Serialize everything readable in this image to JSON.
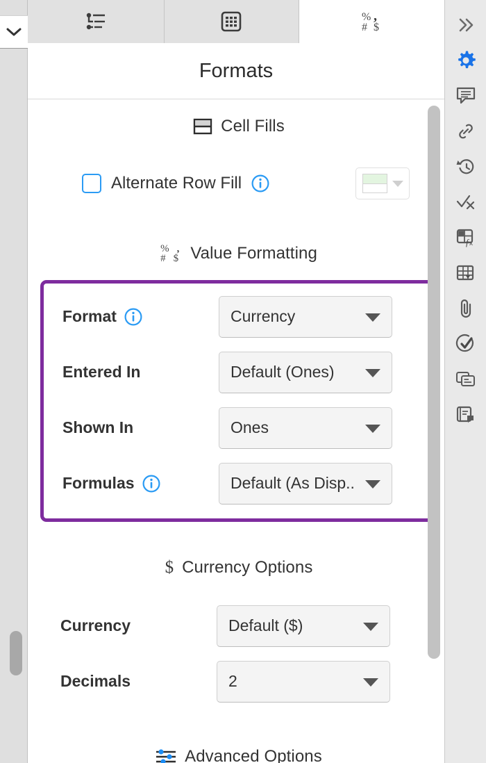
{
  "window": {
    "title": "Formats"
  },
  "left_rail": {
    "collapse_button": {
      "name": "collapse-panel",
      "icon": "chevron-down-icon"
    },
    "scrollbar": {
      "name": "left-scrollbar"
    }
  },
  "tabs": [
    {
      "id": "tab-outline",
      "icon": "outline-list-icon",
      "label": "Outline",
      "active": false
    },
    {
      "id": "tab-table",
      "icon": "grid-table-icon",
      "label": "Table",
      "active": false
    },
    {
      "id": "tab-formats",
      "icon": "number-format-icon",
      "label": "Formats",
      "active": true
    }
  ],
  "sections": [
    {
      "id": "cell-fills",
      "icon": "cell-fill-icon",
      "title": "Cell Fills",
      "checkbox": {
        "label": "Alternate Row Fill",
        "checked": false,
        "info": "i",
        "swatch": {
          "top_color": "#e3f5e0",
          "bottom_color": "#ffffff"
        }
      }
    },
    {
      "id": "value-formatting",
      "icon": "number-format-icon",
      "title": "Value Formatting",
      "highlighted": true,
      "highlight_color": "#7e2c9e",
      "fields": [
        {
          "label": "Format",
          "info": "i",
          "value": "Currency"
        },
        {
          "label": "Entered In",
          "info": null,
          "value": "Default (Ones)"
        },
        {
          "label": "Shown In",
          "info": null,
          "value": "Ones"
        },
        {
          "label": "Formulas",
          "info": "i",
          "value": "Default (As Disp..."
        }
      ]
    },
    {
      "id": "currency-options",
      "icon": "dollar-icon",
      "icon_glyph": "$",
      "title": "Currency Options",
      "fields": [
        {
          "label": "Currency",
          "info": null,
          "value": "Default ($)"
        },
        {
          "label": "Decimals",
          "info": null,
          "value": "2"
        }
      ]
    },
    {
      "id": "advanced-options",
      "icon": "sliders-icon",
      "title": "Advanced Options"
    }
  ],
  "right_rail": [
    {
      "id": "expand",
      "icon": "chevrons-right-icon",
      "active": false
    },
    {
      "id": "settings",
      "icon": "gear-icon",
      "active": true
    },
    {
      "id": "comments",
      "icon": "comment-icon",
      "active": false
    },
    {
      "id": "links",
      "icon": "link-icon",
      "active": false
    },
    {
      "id": "history",
      "icon": "history-icon",
      "active": false
    },
    {
      "id": "check-x",
      "icon": "check-x-icon",
      "active": false
    },
    {
      "id": "formula",
      "icon": "formula-table-icon",
      "active": false
    },
    {
      "id": "table-menu",
      "icon": "table-dropdown-icon",
      "active": false
    },
    {
      "id": "attachments",
      "icon": "paperclip-icon",
      "active": false
    },
    {
      "id": "approvals",
      "icon": "check-circle-icon",
      "active": false
    },
    {
      "id": "cards",
      "icon": "cards-icon",
      "active": false
    },
    {
      "id": "notes",
      "icon": "note-comment-icon",
      "active": false
    }
  ],
  "colors": {
    "accent_blue": "#2b9bf4",
    "highlight_purple": "#7e2c9e",
    "panel_bg": "#ffffff",
    "rail_bg": "#e9e9e9"
  }
}
